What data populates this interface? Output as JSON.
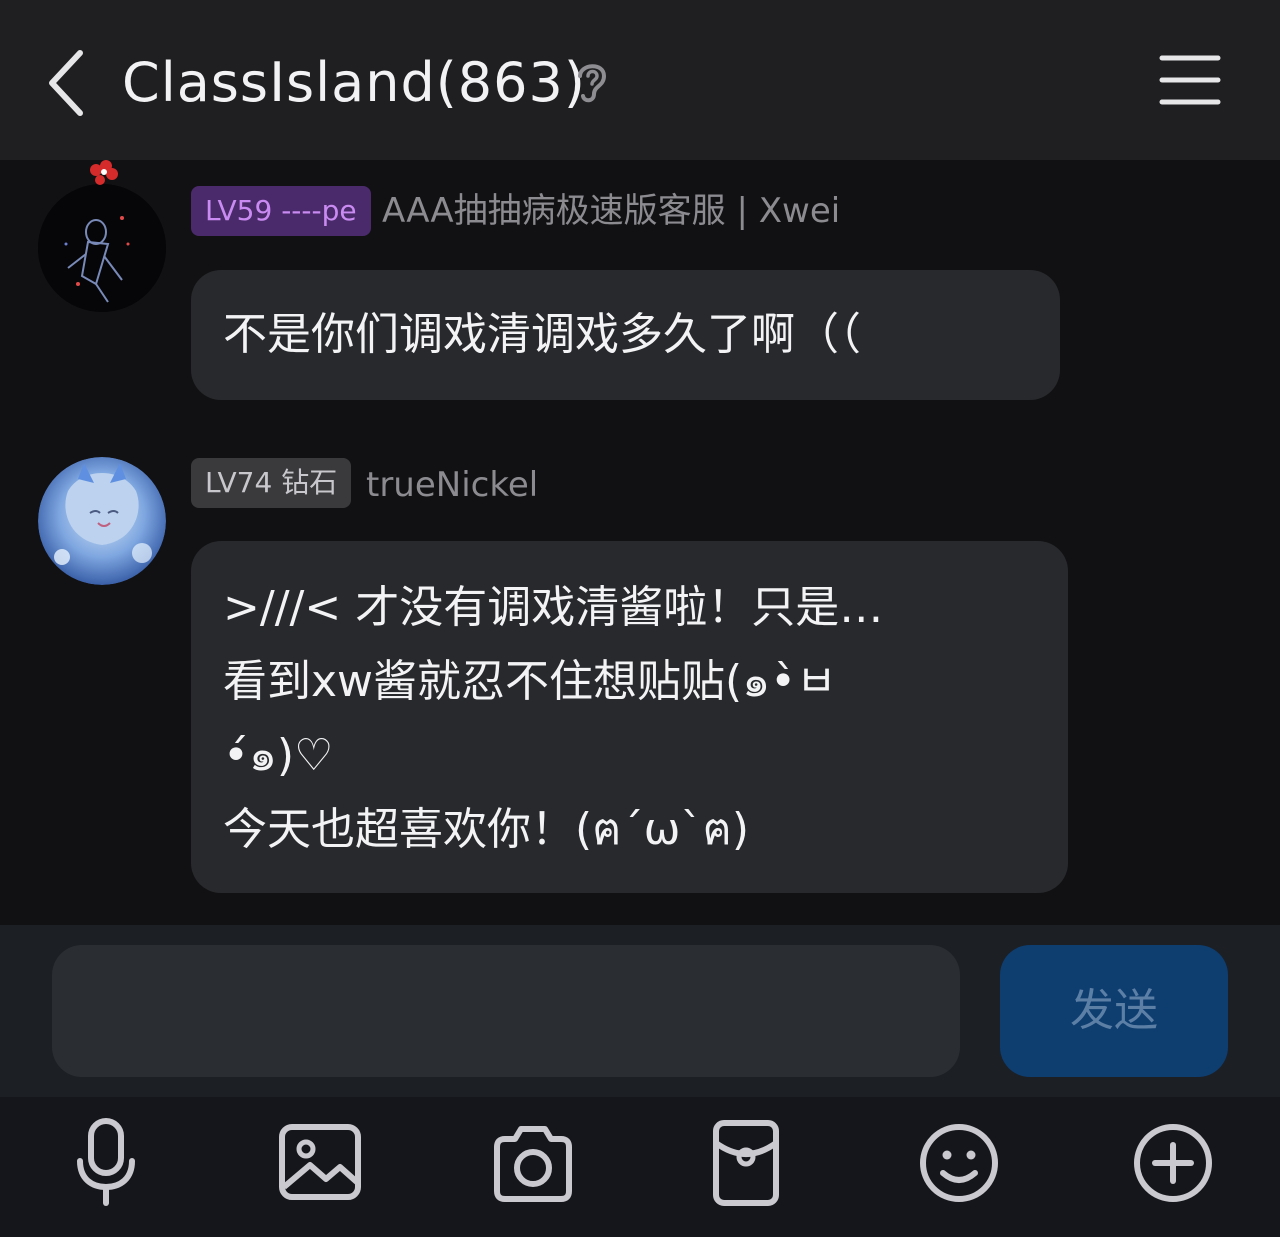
{
  "header": {
    "title": "ClassIsland(863)",
    "back_icon": "chevron-left-icon",
    "ear_icon": "ear-icon",
    "menu_icon": "hamburger-menu-icon"
  },
  "messages": [
    {
      "badge": "LV59 ----pe",
      "badge_color": "#4a2a6a",
      "badge_text_color": "#c98bf2",
      "name": "AAA抽抽病极速版客服 | Xwei",
      "lines": [
        "不是你们调戏清调戏多久了啊（（"
      ]
    },
    {
      "badge": "LV74 钻石",
      "badge_color": "#3a3a3d",
      "badge_text_color": "#c8c8cc",
      "name": "trueNickel",
      "lines": [
        ">///< 才没有调戏清酱啦！只是…",
        "看到xw酱就忍不住想贴贴(๑•̀ㅂ",
        "•́๑)♡",
        "今天也超喜欢你！(ฅ´ω`ฅ)"
      ]
    }
  ],
  "composer": {
    "placeholder": "",
    "send_label": "发送"
  },
  "toolbar": {
    "icons": [
      "microphone-icon",
      "image-icon",
      "camera-icon",
      "red-packet-icon",
      "emoji-icon",
      "plus-icon"
    ]
  },
  "colors": {
    "header_bg": "#1f1f21",
    "chat_bg": "#111113",
    "bubble_bg": "#27292c",
    "send_bg": "#0e3d70",
    "toolbar_bg": "#15161c"
  }
}
